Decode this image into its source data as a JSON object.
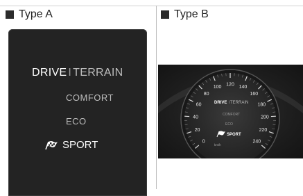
{
  "captions": {
    "type_a": "Type A",
    "type_b": "Type B"
  },
  "type_a": {
    "drive": "DRIVE",
    "separator": "I",
    "terrain": "TERRAIN",
    "modes": {
      "comfort": "COMFORT",
      "eco": "ECO",
      "sport": "SPORT"
    },
    "sport_icon": "checkered-flag-icon"
  },
  "type_b": {
    "speed_ticks": [
      "0",
      "20",
      "40",
      "60",
      "80",
      "100",
      "120",
      "140",
      "160",
      "180",
      "200",
      "220",
      "240"
    ],
    "unit": "km/h",
    "drive": "DRIVE",
    "separator": "I",
    "terrain": "TERRAIN",
    "modes": {
      "comfort": "COMFORT",
      "eco": "ECO",
      "sport": "SPORT"
    }
  },
  "colors": {
    "panel_a_bg": "#232323",
    "panel_b_bg": "#1a1a1a",
    "active_text": "#ffffff",
    "inactive_text": "#bdbdbd"
  }
}
